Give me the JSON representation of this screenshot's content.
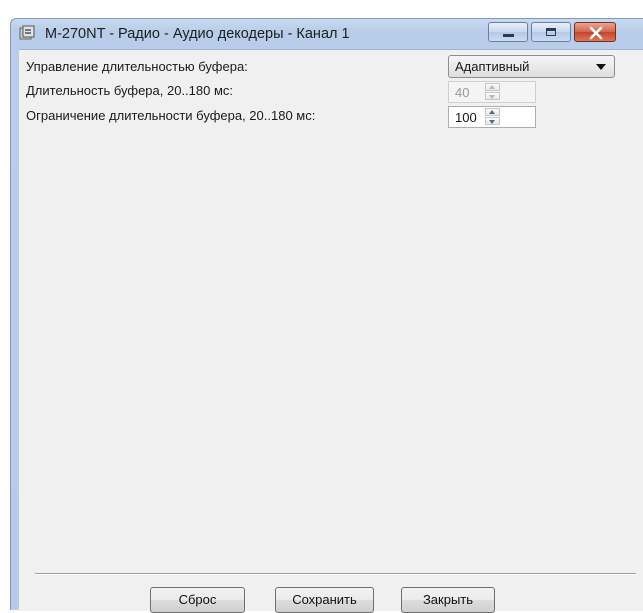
{
  "window": {
    "title": "M-270NT - Радио - Аудио декодеры - Канал 1",
    "icon": "app-window-icon"
  },
  "settings": {
    "buffer_mode": {
      "label": "Управление длительностью буфера:",
      "value": "Адаптивный"
    },
    "buffer_duration": {
      "label": "Длительность буфера, 20..180 мс:",
      "value": "40",
      "enabled": false
    },
    "buffer_limit": {
      "label": "Ограничение длительности буфера, 20..180 мс:",
      "value": "100",
      "enabled": true
    }
  },
  "buttons": {
    "reset": "Сброс",
    "save": "Сохранить",
    "close": "Закрыть"
  },
  "colors": {
    "titlebar": "#b8cde9",
    "client_bg": "#f0f0f0",
    "close_button": "#c4452a"
  }
}
